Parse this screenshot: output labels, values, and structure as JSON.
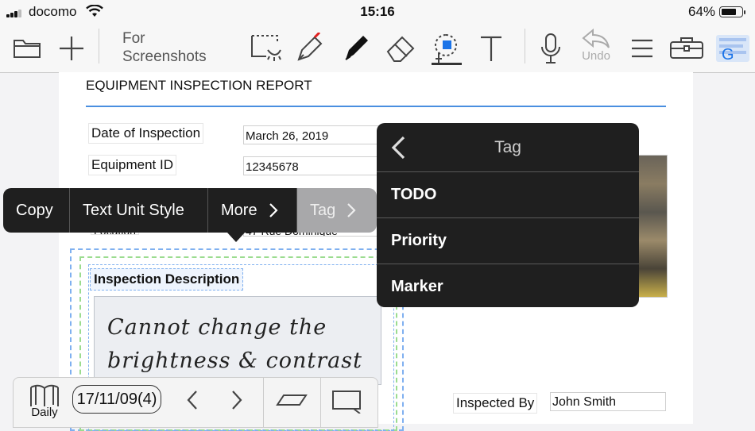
{
  "status_bar": {
    "carrier": "docomo",
    "time": "15:16",
    "battery_percent": "64%"
  },
  "toolbar": {
    "notebook_line1": "For",
    "notebook_line2": "Screenshots",
    "undo_label": "Undo",
    "pen_color": "#e02020",
    "select_color": "#1a73e8"
  },
  "document": {
    "title": "EQUIPMENT INSPECTION REPORT",
    "date_label": "Date of Inspection",
    "date_value": "March 26, 2019",
    "equipment_label": "Equipment ID",
    "equipment_value": "12345678",
    "location_partial": "Location",
    "location_value_partial": "47 Rue Dominique",
    "inspection_description_label": "Inspection Description",
    "handwriting_line1": "Cannot change the",
    "handwriting_line2": "brightness & contrast",
    "inspected_by_label": "Inspected By",
    "inspected_by_value": "John Smith"
  },
  "context_menu": {
    "items": [
      "Copy",
      "Text Unit Style",
      "More",
      "Tag"
    ]
  },
  "tag_menu": {
    "title": "Tag",
    "items": [
      "TODO",
      "Priority",
      "Marker"
    ]
  },
  "bottom_bar": {
    "daily_label": "Daily",
    "date_button": "17/11/09(4)"
  }
}
